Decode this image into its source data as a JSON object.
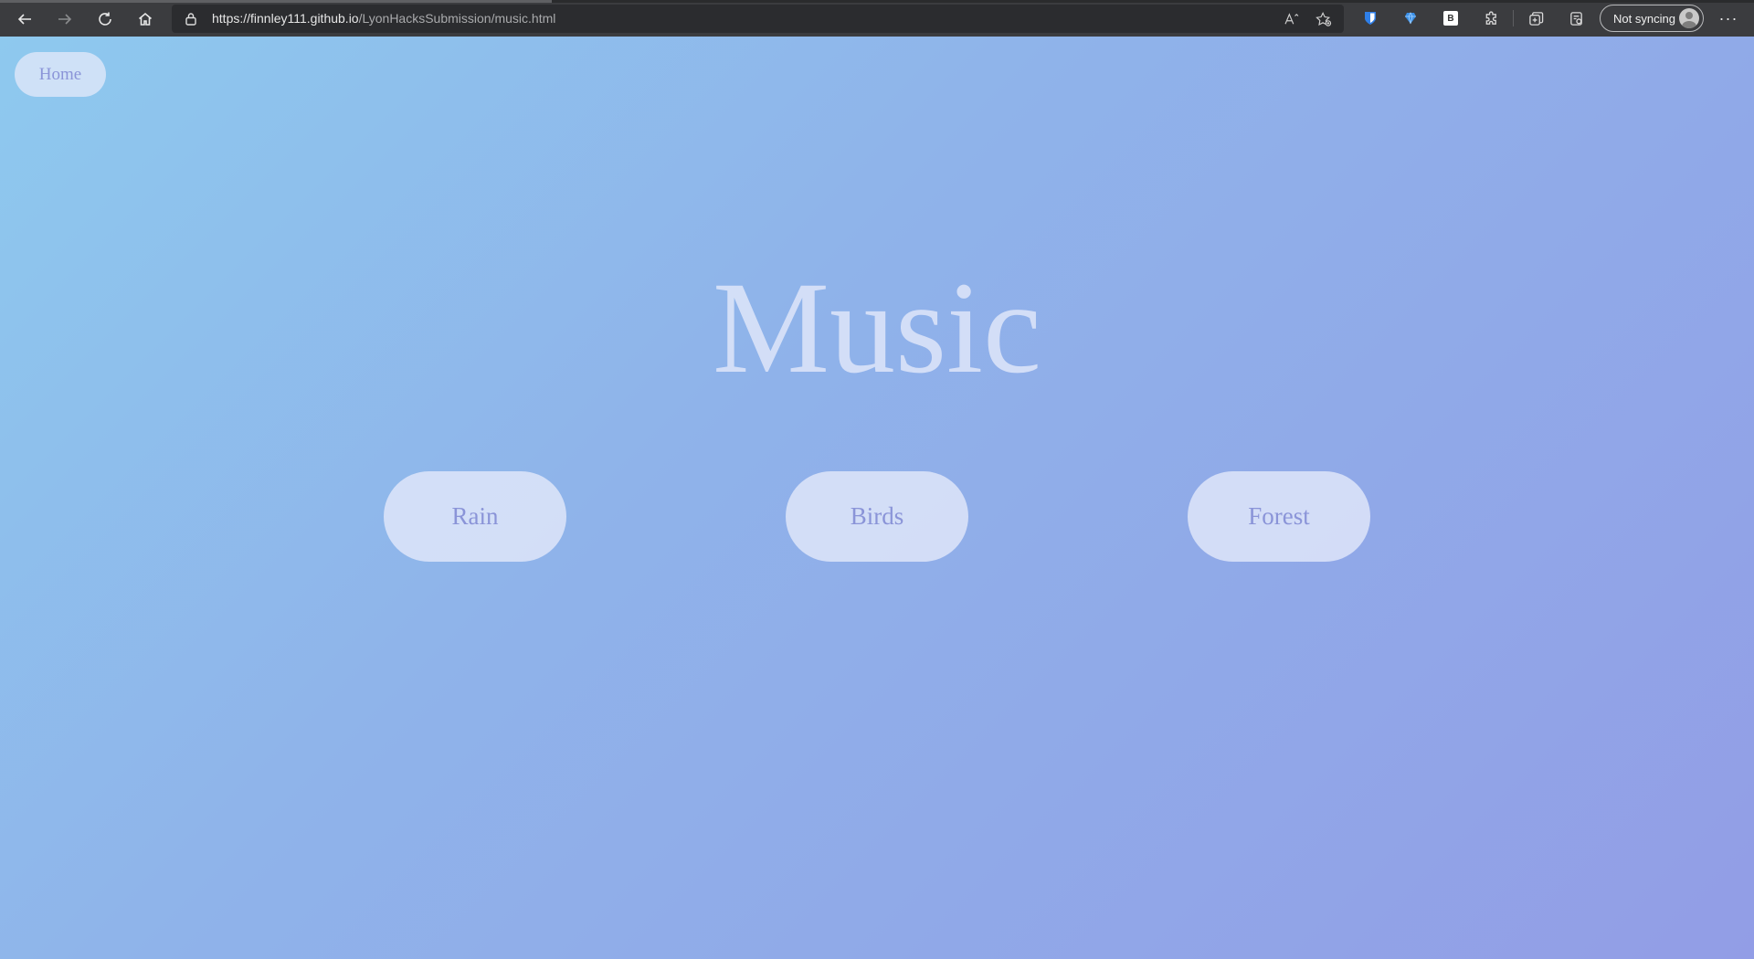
{
  "browser": {
    "url_host": "https://finnley111.github.io",
    "url_path": "/LyonHacksSubmission/music.html",
    "sync_label": "Not syncing",
    "more_label": "···"
  },
  "page": {
    "home_label": "Home",
    "title": "Music",
    "buttons": [
      {
        "label": "Rain"
      },
      {
        "label": "Birds"
      },
      {
        "label": "Forest"
      }
    ]
  },
  "colors": {
    "gradient_start": "#8ec9ee",
    "gradient_end": "#929de6",
    "button_fill": "#e2e8fa",
    "button_text": "#8a94d8"
  }
}
